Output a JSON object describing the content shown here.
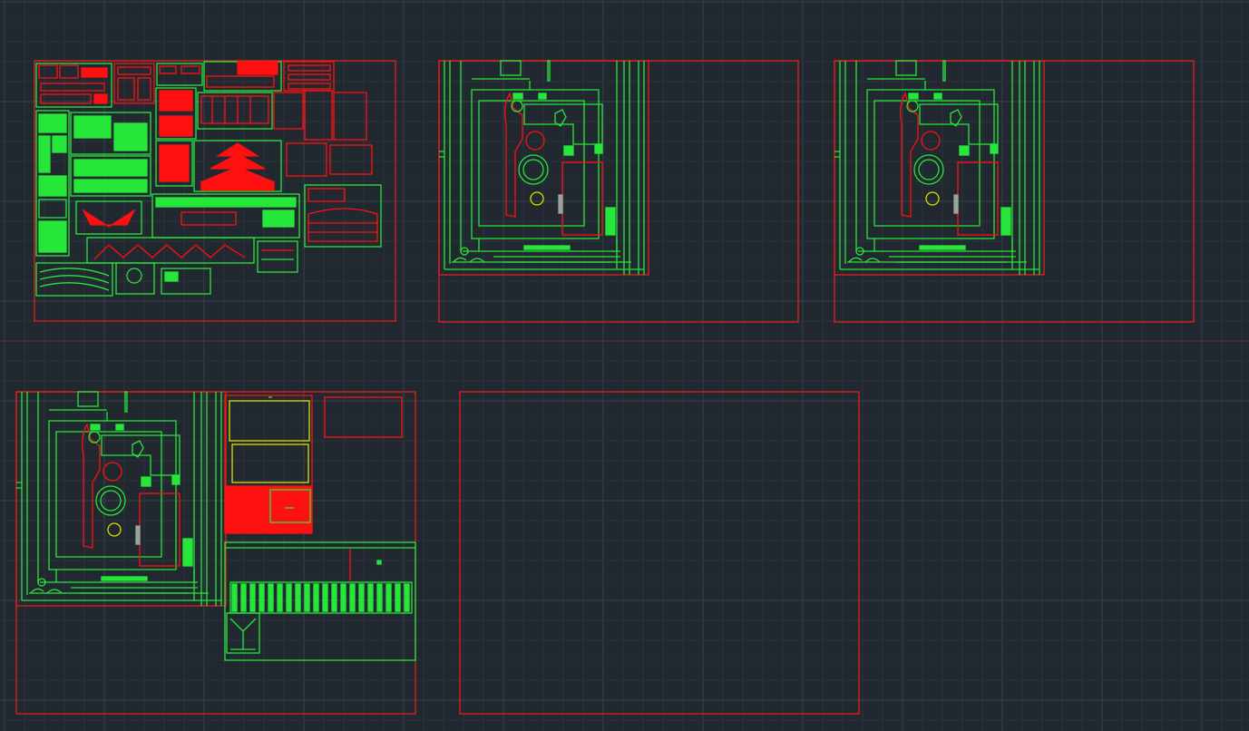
{
  "app": {
    "viewport_type": "cad-model-space",
    "background_color": "#212830",
    "grid_minor_color": "#2a323c",
    "grid_major_color": "#37404c",
    "axis_color": "#4a3436"
  },
  "colors": {
    "frame": "#e0201a",
    "linework_green": "#27e63a",
    "linework_red": "#ff1010",
    "linework_yellow": "#d8e000"
  },
  "drawing_sheets": [
    {
      "id": "sheet-1",
      "content": "detail-sheet"
    },
    {
      "id": "sheet-2",
      "content": "site-plan"
    },
    {
      "id": "sheet-3",
      "content": "site-plan"
    },
    {
      "id": "sheet-4",
      "content": "site-plan-with-details"
    },
    {
      "id": "sheet-5",
      "content": "empty"
    }
  ]
}
